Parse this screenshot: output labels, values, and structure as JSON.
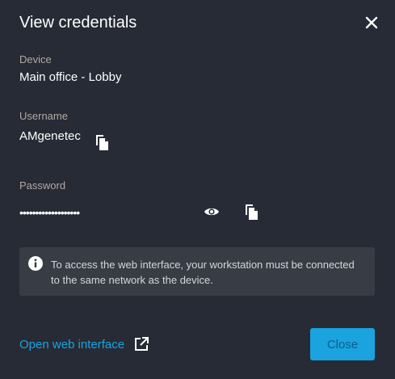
{
  "dialog": {
    "title": "View credentials",
    "close_icon": "close-icon"
  },
  "device": {
    "label": "Device",
    "value": "Main office - Lobby"
  },
  "username": {
    "label": "Username",
    "value": "AMgenetec",
    "copy_icon": "copy-icon"
  },
  "password": {
    "label": "Password",
    "masked_value": "•••••••••••••••••••",
    "reveal_icon": "eye-icon",
    "copy_icon": "copy-icon"
  },
  "info": {
    "icon": "info-icon",
    "text": "To access the web interface, your workstation must be connected to the same network as the device."
  },
  "footer": {
    "link_label": "Open web interface",
    "link_icon": "external-link-icon",
    "close_label": "Close"
  },
  "colors": {
    "background": "#262b35",
    "label": "#b3a8a3",
    "accent": "#1ba3e0",
    "info_box": "#373c45"
  }
}
